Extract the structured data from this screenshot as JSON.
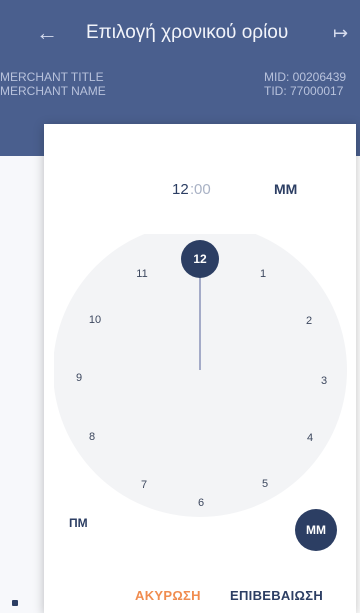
{
  "header": {
    "back_icon": "arrow-left-icon",
    "title": "Επιλογή χρονικού ορίου",
    "exit_icon": "exit-icon"
  },
  "merchant": {
    "title": "MERCHANT TITLE",
    "name": "MERCHANT NAME",
    "mid": "MID: 00206439",
    "tid": "TID: 77000017"
  },
  "time_picker": {
    "hour": "12",
    "separator": ":",
    "minutes": "00",
    "selected_period": "ΜΜ",
    "clock_numbers": [
      "12",
      "1",
      "2",
      "3",
      "4",
      "5",
      "6",
      "7",
      "8",
      "9",
      "10",
      "11"
    ],
    "selected_hour": "12",
    "pm_label": "ΠΜ",
    "am_label": "ΜΜ"
  },
  "actions": {
    "cancel": "ΑΚΥΡΩΣΗ",
    "confirm": "ΕΠΙΒΕΒΑΙΩΣΗ"
  },
  "colors": {
    "header": "#4a5f8e",
    "accent": "#2c3e63",
    "cancel": "#f08c4f"
  }
}
